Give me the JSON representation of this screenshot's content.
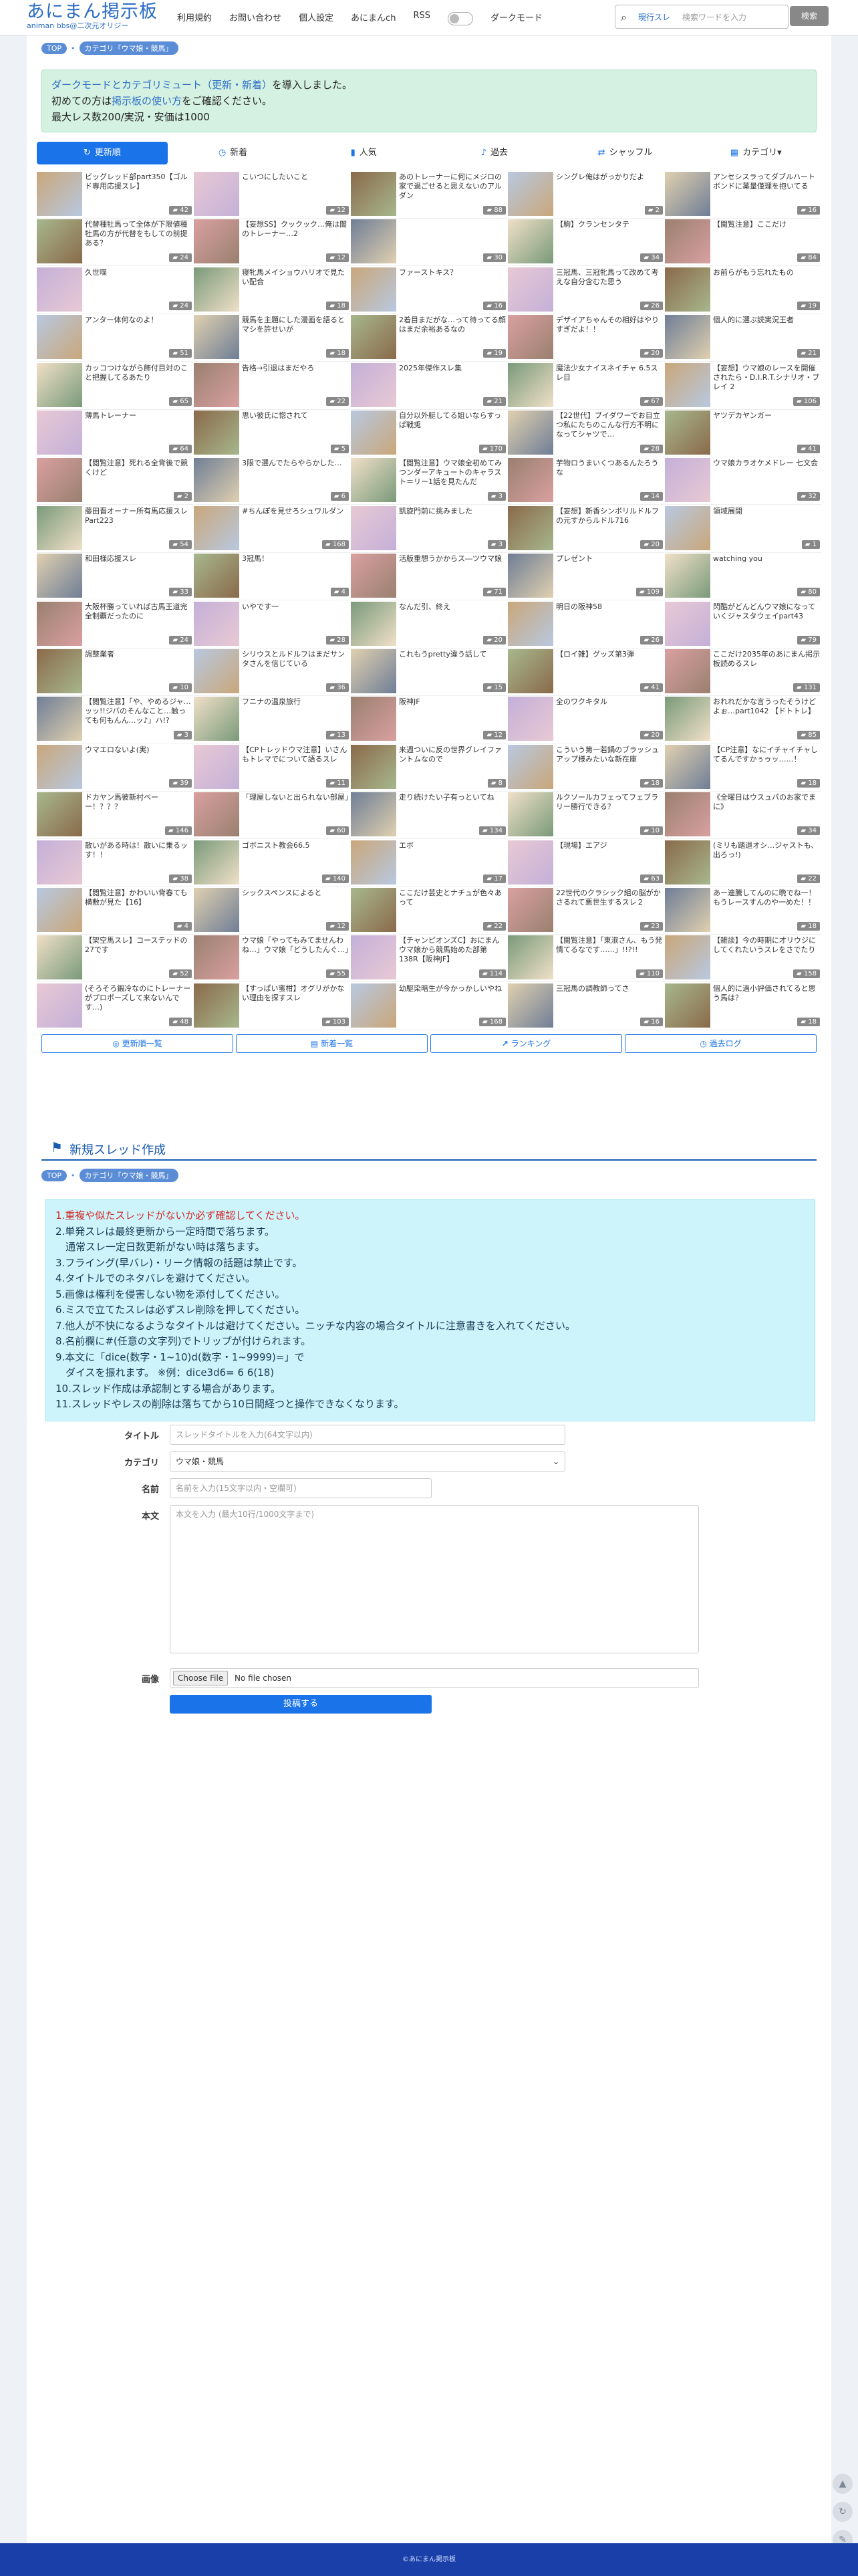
{
  "header": {
    "logo": "あにまん掲示板",
    "logo_sub": "animan bbs@二次元オリジー",
    "nav": [
      "利用規約",
      "お問い合わせ",
      "個人設定",
      "あにまんch",
      "RSS"
    ],
    "dark_mode_label": "ダークモード",
    "search_scope": "現行スレ",
    "search_placeholder": "検索ワードを入力",
    "search_button": "検索"
  },
  "breadcrumb": {
    "top": "TOP",
    "category": "カテゴリ「ウマ娘・競馬」"
  },
  "notice": {
    "line1_link": "ダークモードとカテゴリミュート（更新・新着）",
    "line1_rest": "を導入しました。",
    "line2_pre": "初めての方は",
    "line2_link": "掲示板の使い方",
    "line2_post": "をご確認ください。",
    "line3": "最大レス数200/実況・安価は1000"
  },
  "tabs": [
    {
      "label": "更新順",
      "icon": "↻"
    },
    {
      "label": "新着",
      "icon": "◷"
    },
    {
      "label": "人気",
      "icon": "▮"
    },
    {
      "label": "過去",
      "icon": "♪"
    },
    {
      "label": "シャッフル",
      "icon": "⇄"
    },
    {
      "label": "カテゴリ▾",
      "icon": "▦"
    }
  ],
  "threads": [
    {
      "title": "ビッグレッド部part350【ゴルド専用応援スレ】",
      "count": "42"
    },
    {
      "title": "こいつにしたいこと",
      "count": "12"
    },
    {
      "title": "あのトレーナーに何にメジロの家で過ごせると思えないのアルダン",
      "count": "88"
    },
    {
      "title": "シングレ俺はがっかりだよ",
      "count": "2"
    },
    {
      "title": "アンセシスラってダブルハートボンドに薬量僅理を抱いてる",
      "count": "16"
    },
    {
      "title": "代替種牡馬って全体が下限値種牡馬の方が代替をもしての前提ある？",
      "count": "24"
    },
    {
      "title": "【妄想SS】クックック…俺は闇のトレーナー…2",
      "count": "12"
    },
    {
      "title": "",
      "count": "30"
    },
    {
      "title": "【駒】クランセンタテ",
      "count": "34"
    },
    {
      "title": "【閲覧注意】ここだけ",
      "count": "84"
    },
    {
      "title": "久世喋",
      "count": "24"
    },
    {
      "title": "寝牝馬メイショウハリオで見たい配合",
      "count": "18"
    },
    {
      "title": "ファーストキス？",
      "count": "16"
    },
    {
      "title": "三冠馬、三冠牝馬って改めて考えな自分含むた思う",
      "count": "26"
    },
    {
      "title": "お前らがもう忘れたもの",
      "count": "19"
    },
    {
      "title": "アンター体何なのよ！",
      "count": "51"
    },
    {
      "title": "競馬を主題にした漫画を語るとマシを許せいが",
      "count": "18"
    },
    {
      "title": "2着目まだがな…って待ってる顔はまだ余裕あるなの",
      "count": "19"
    },
    {
      "title": "デザイアちゃんその相好はやりすぎだよ！！",
      "count": "20"
    },
    {
      "title": "個人的に選ぶ読実況王者",
      "count": "21"
    },
    {
      "title": "カッコつけながら飾付目対のこと把握してるあたり",
      "count": "65"
    },
    {
      "title": "告格→引退はまだやろ",
      "count": "22"
    },
    {
      "title": "2025年傑作スレ集",
      "count": "21"
    },
    {
      "title": "魔法少女ナイスネイチャ 6.5スレ目",
      "count": "67"
    },
    {
      "title": "【妄想】ウマ娘のレースを開催されたら・D.I.R.T.シナリオ・ブレイ 2",
      "count": "106"
    },
    {
      "title": "薄馬トレーナー",
      "count": "64"
    },
    {
      "title": "思い彼氏に惚されて",
      "count": "5"
    },
    {
      "title": "自分以外艇してる姐いならすっぱ戦兎",
      "count": "170"
    },
    {
      "title": "【22世代】ブイダワーでお目立つ私にたちのこんな行方不明になってシャツで…",
      "count": "28"
    },
    {
      "title": "ヤツデカヤンガー",
      "count": "41"
    },
    {
      "title": "【閲覧注意】死れる全背後で競くけど",
      "count": "2"
    },
    {
      "title": "3限で選んでたらやらかした…",
      "count": "6"
    },
    {
      "title": "【閲覧注意】ウマ娘全初めてみつンダーアキュートのキャラスト＝リー1話を見たんだ",
      "count": "3"
    },
    {
      "title": "芋物ロうまいくつあるんたろうな",
      "count": "14"
    },
    {
      "title": "ウマ娘カラオケメドレー 七文会",
      "count": "32"
    },
    {
      "title": "藤田晋オーナー所有馬応援スレPart223",
      "count": "54"
    },
    {
      "title": "#ちんぽを見せろシュワルダン",
      "count": "168"
    },
    {
      "title": "凱旋門前に挑みました",
      "count": "3"
    },
    {
      "title": "【妄想】新香シンボリルドルフの元すからルドル716",
      "count": "20"
    },
    {
      "title": "領域展開",
      "count": "1"
    },
    {
      "title": "和田様応援スレ",
      "count": "33"
    },
    {
      "title": "3冠馬！",
      "count": "4"
    },
    {
      "title": "活版重想うかからス―ツウマ娘",
      "count": "71"
    },
    {
      "title": "プレゼント",
      "count": "109"
    },
    {
      "title": "watching you",
      "count": "80"
    },
    {
      "title": "大阪杯勝っていれば古馬王道完全制覇だったのに",
      "count": "24"
    },
    {
      "title": "いやです一",
      "count": "28"
    },
    {
      "title": "なんだ引、終え",
      "count": "20"
    },
    {
      "title": "明日の阪神58",
      "count": "26"
    },
    {
      "title": "閃酷がどんどんウマ娘になっていくジャスタウェイpart43",
      "count": "79"
    },
    {
      "title": "調整業者",
      "count": "10"
    },
    {
      "title": "シリウスとルドルフはまだサンタさんを信じている",
      "count": "36"
    },
    {
      "title": "これもうpretty違う話して",
      "count": "15"
    },
    {
      "title": "【ロイ雑】グッズ第3弾",
      "count": "41"
    },
    {
      "title": "ここだけ2035年のあにまん掲示板読めるスレ",
      "count": "131"
    },
    {
      "title": "【閲覧注意】「や、やめるジャ…ッッ!!ジバのそんなこと…触っても何もんん…ッ♪」ハ!?",
      "count": "3"
    },
    {
      "title": "フニナの温泉旅行",
      "count": "13"
    },
    {
      "title": "阪神JF",
      "count": "12"
    },
    {
      "title": "全のワクキタル",
      "count": "20"
    },
    {
      "title": "おれれだかな言うったそうけどよぉ…part1042 【ドトトレ】",
      "count": "85"
    },
    {
      "title": "ウマエロないよ(実)",
      "count": "39"
    },
    {
      "title": "【CPトレッドウマ注意】いさんもトレマでについて語るスレ",
      "count": "11"
    },
    {
      "title": "来週ついに反の世界グレイファントムなので",
      "count": "8"
    },
    {
      "title": "こういう第一若鍋のブラッシュアップ様みたいな新在庫",
      "count": "18"
    },
    {
      "title": "【CP注意】なにイチャイチャしてるんですかぅゥッ……！",
      "count": "18"
    },
    {
      "title": "ドカヤン馬彼新村ベーー！？？？",
      "count": "146"
    },
    {
      "title": "「理屋しないと出られない部屋」",
      "count": "60"
    },
    {
      "title": "走り続けたい子有っといてね",
      "count": "134"
    },
    {
      "title": "ルクソールカフェってフェブラリー勝行できる？",
      "count": "10"
    },
    {
      "title": "《全曜日はウスュパのお家でまに》",
      "count": "34"
    },
    {
      "title": "散いがある時は！散いに乗るッす！！",
      "count": "38"
    },
    {
      "title": "ゴボニスト教会66.5",
      "count": "140"
    },
    {
      "title": "エボ",
      "count": "17"
    },
    {
      "title": "【現場】エアジ",
      "count": "63"
    },
    {
      "title": "(ミリも踏退オシ…ジャストも、出ろっ!)",
      "count": "22"
    },
    {
      "title": "【閲覧注意】かわいい背春ても横敷が見た【16】",
      "count": "4"
    },
    {
      "title": "シックスペンスによると",
      "count": "12"
    },
    {
      "title": "ここだけ芸史とナチュが色々あって",
      "count": "22"
    },
    {
      "title": "22世代のクラシック組の脳がかさるれて悪世生するスレ２",
      "count": "23"
    },
    {
      "title": "あー連騰してんのに晩でね一！もうレースすんのや一めた！！",
      "count": "18"
    },
    {
      "title": "【架空馬スレ】コーステッドの27です",
      "count": "52"
    },
    {
      "title": "ウマ娘「やってもみてませんわね…」ウマ娘「どうしたんぐ…」",
      "count": "55"
    },
    {
      "title": "【チャンピオンズC】おにまんウマ娘から競馬始めた部第138R【阪神JF】",
      "count": "114"
    },
    {
      "title": "【閲覧注意】「東淑さん、もう発情てるなです……」!!?!!",
      "count": "110"
    },
    {
      "title": "【雑談】今の時期に才リウジにしてくれたいうスレをさでたり",
      "count": "158"
    },
    {
      "title": "(そろそろ鍛冷なのにトレーナーがプロポーズして来ないんです…)",
      "count": "48"
    },
    {
      "title": "【すっぱい蜜柑】オグリがかない理由を探すスレ",
      "count": "103"
    },
    {
      "title": "幼駆染暗生が今かっかしいやね",
      "count": "168"
    },
    {
      "title": "三冠馬の調教師ってさ",
      "count": "16"
    },
    {
      "title": "個人的に過小評価されてると思う馬は？",
      "count": "18"
    }
  ],
  "bottom_links": [
    {
      "label": "更新順一覧",
      "icon": "◎"
    },
    {
      "label": "新着一覧",
      "icon": "▤"
    },
    {
      "label": "ランキング",
      "icon": "↗"
    },
    {
      "label": "過去ログ",
      "icon": "◷"
    }
  ],
  "new_thread": {
    "heading": "新規スレッド作成",
    "rules": [
      {
        "text": "1.重複や似たスレッドがないか必ず確認してください。",
        "style": "red"
      },
      {
        "text": "2.単発スレは最終更新から一定時間で落ちます。",
        "style": ""
      },
      {
        "text": "　通常スレ一定日数更新がない時は落ちます。",
        "style": ""
      },
      {
        "text": "3.フライング(早バレ)・リーク情報の話題は禁止です。",
        "style": ""
      },
      {
        "text": "4.タイトルでのネタバレを避けてください。",
        "style": ""
      },
      {
        "text": "5.画像は権利を侵害しない物を添付してください。",
        "style": ""
      },
      {
        "text": "6.ミスで立てたスレは必ずスレ削除を押してください。",
        "style": ""
      },
      {
        "text": "7.他人が不快になるようなタイトルは避けてください。ニッチな内容の場合タイトルに注意書きを入れてください。",
        "style": ""
      },
      {
        "text": "8.名前欄に#(任意の文字列)でトリップが付けられます。",
        "style": "blue-part"
      },
      {
        "text": "9.本文に「dice(数字・1~10)d(数字・1~9999)=」で",
        "style": ""
      },
      {
        "text": "　ダイスを振れます。 ※例：dice3d6= 6 6(18)",
        "style": ""
      },
      {
        "text": "10.スレッド作成は承認制とする場合があります。",
        "style": ""
      },
      {
        "text": "11.スレッドやレスの削除は落ちてから10日間経つと操作できなくなります。",
        "style": ""
      }
    ],
    "form": {
      "title_label": "タイトル",
      "title_placeholder": "スレッドタイトルを入力(64文字以内)",
      "category_label": "カテゴリ",
      "category_value": "ウマ娘・競馬",
      "name_label": "名前",
      "name_placeholder": "名前を入力(15文字以内・空欄可)",
      "body_label": "本文",
      "body_placeholder": "本文を入力 (最大10行/1000文字まで)",
      "image_label": "画像",
      "choose_file": "Choose File",
      "no_file": "No file chosen",
      "submit": "投稿する"
    }
  },
  "footer": "©あにまん掲示板",
  "colors": {
    "accent": "#1a73e8",
    "brand": "#2b6cc4",
    "notice_bg": "#d4f1e2",
    "rules_bg": "#cdf4fa",
    "footer_bg": "#1a3fa8"
  }
}
